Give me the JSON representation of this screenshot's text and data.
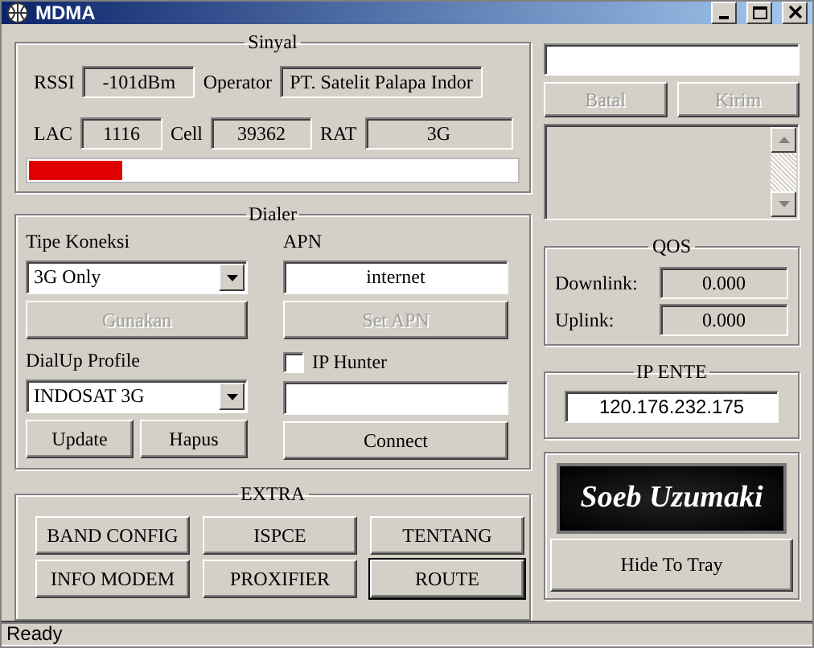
{
  "window": {
    "title": "MDMA"
  },
  "sinyal": {
    "title": "Sinyal",
    "row_1": [
      {
        "label": "RSSI",
        "value": "-101dBm"
      },
      {
        "label": "Operator",
        "value": "PT. Satelit Palapa Indor"
      }
    ],
    "row_2": [
      {
        "label": "LAC",
        "value": "1116"
      },
      {
        "label": "Cell",
        "value": "39362"
      },
      {
        "label": "RAT",
        "value": "3G"
      }
    ],
    "signal": {
      "level": 0.19
    }
  },
  "dialer": {
    "title": "Dialer",
    "connection_type": {
      "label": "Tipe Koneksi",
      "value": "3G Only"
    },
    "use_button": {
      "label": "Gunakan",
      "disabled": true
    },
    "apn": {
      "label": "APN",
      "value": "internet"
    },
    "set_apn_button": {
      "label": "Set APN",
      "disabled": true
    },
    "dialup_profile": {
      "label": "DialUp Profile",
      "value": "INDOSAT 3G"
    },
    "ip_hunter": {
      "label": "IP Hunter",
      "checked": false
    },
    "profile_buttons": [
      {
        "label": "Update",
        "disabled": false
      },
      {
        "label": "Hapus",
        "disabled": false
      }
    ],
    "connect_button": {
      "label": "Connect",
      "disabled": false
    }
  },
  "extra": {
    "title": "EXTRA",
    "buttons": [
      {
        "label": "BAND CONFIG",
        "focused": false
      },
      {
        "label": "ISPCE",
        "focused": false
      },
      {
        "label": "TENTANG",
        "focused": false
      },
      {
        "label": "INFO MODEM",
        "focused": false
      },
      {
        "label": "PROXIFIER",
        "focused": false
      },
      {
        "label": "ROUTE",
        "focused": true
      }
    ]
  },
  "sms": {
    "buttons": [
      {
        "label": "Batal",
        "disabled": true
      },
      {
        "label": "Kirim",
        "disabled": true
      }
    ]
  },
  "qos": {
    "title": "QOS",
    "rows": [
      {
        "label": "Downlink:",
        "value": "0.000"
      },
      {
        "label": "Uplink:",
        "value": "0.000"
      }
    ]
  },
  "ip": {
    "title": "IP ENTE",
    "value": "120.176.232.175"
  },
  "logo": {
    "text": "Soeb Uzumaki"
  },
  "hide_button": {
    "label": "Hide To Tray",
    "disabled": false
  },
  "status_bar": {
    "text": "Ready"
  }
}
